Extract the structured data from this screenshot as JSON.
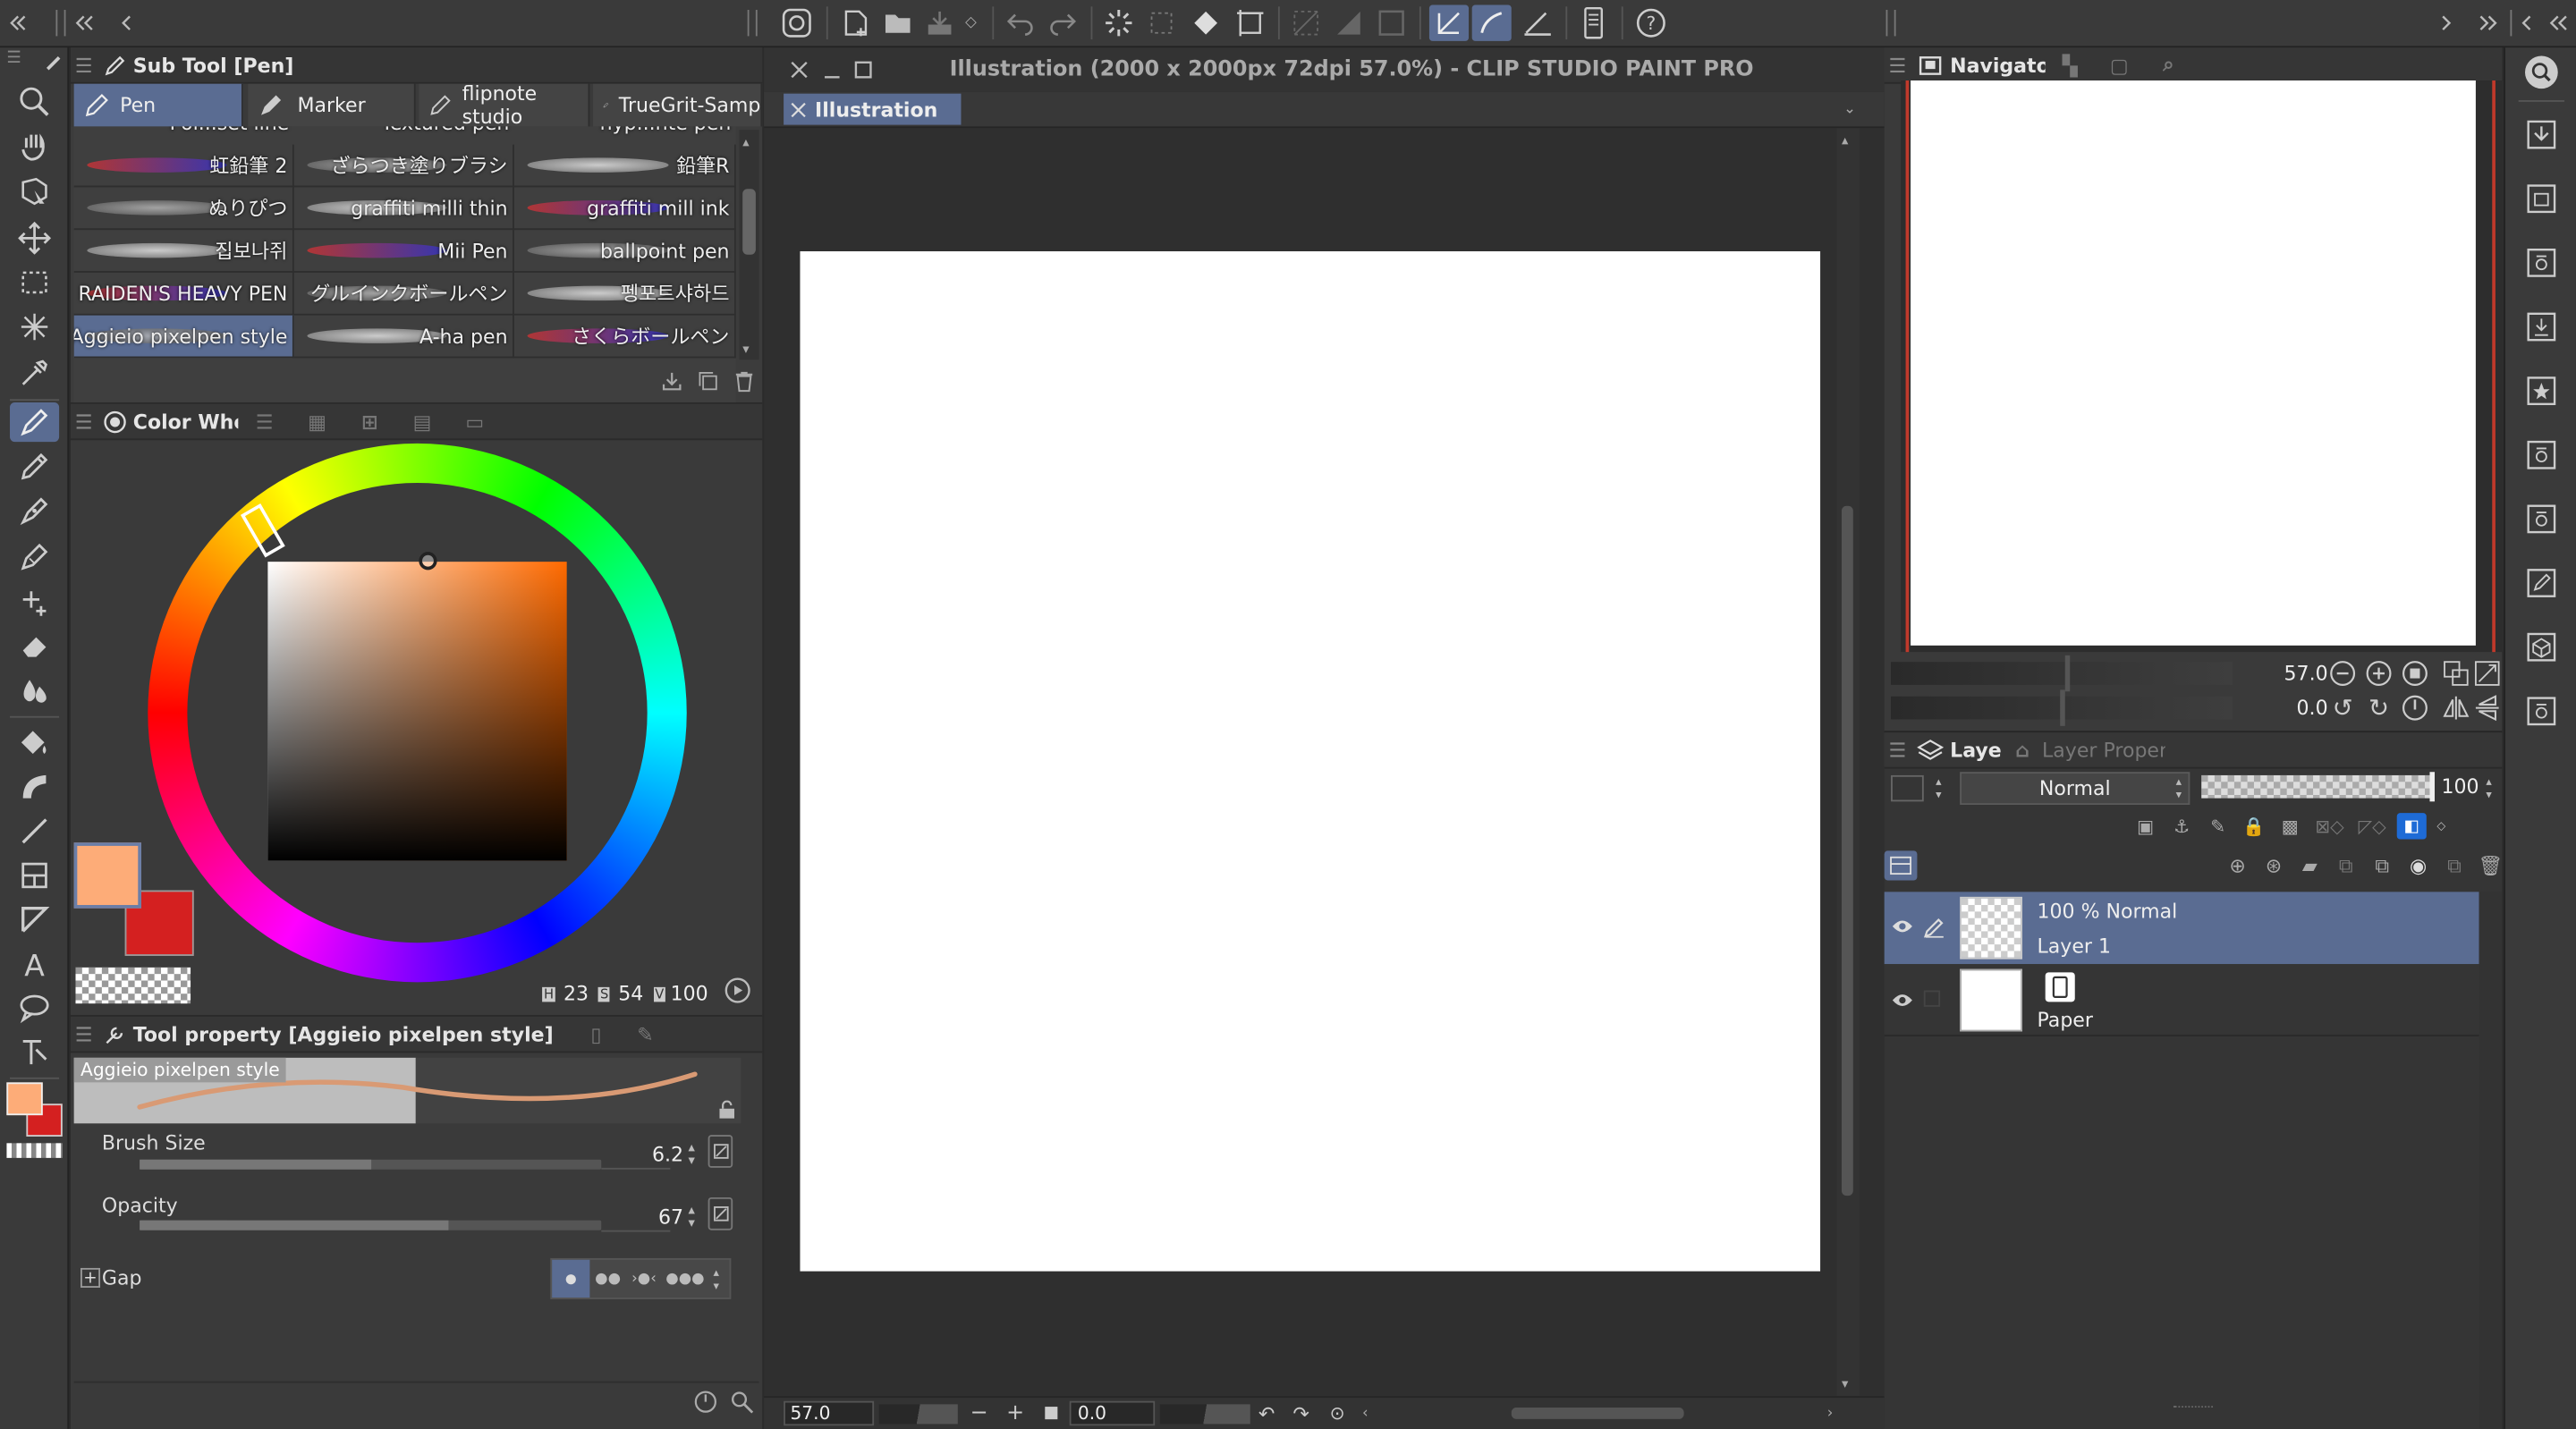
{
  "window": {
    "title": "Illustration (2000 x 2000px 72dpi 57.0%)  - CLIP STUDIO PAINT PRO",
    "tab": "Illustration"
  },
  "subtool": {
    "title": "Sub Tool [Pen]",
    "tabs": [
      "Pen",
      "Marker",
      "flipnote studio",
      "TrueGrit-Samp"
    ],
    "partial_row": [
      "Pol...set line",
      "Textured pen",
      "hyp...nte pen"
    ],
    "brushes": [
      [
        "虹鉛筆 2",
        "ざらつき塗りブラシ",
        "鉛筆R"
      ],
      [
        "ぬりぴつ",
        "graffiti milli thin",
        "graffiti mill ink"
      ],
      [
        "집보나쥐",
        "Mii Pen",
        "ballpoint pen"
      ],
      [
        "RAIDEN'S HEAVY PEN",
        "グルインクボールペン",
        "펭포트샤하드"
      ],
      [
        "Aggieio pixelpen style",
        "A-ha pen",
        "さくらボールペン"
      ]
    ]
  },
  "color": {
    "title": "Color Whee",
    "main": "#fdac78",
    "sub": "#d42020",
    "h": "23",
    "s": "54",
    "v": "100",
    "h_label": "H",
    "s_label": "S",
    "v_label": "V"
  },
  "toolprop": {
    "title": "Tool property [Aggieio pixelpen style]",
    "preview_name": "Aggieio pixelpen style",
    "brush_size_label": "Brush Size",
    "brush_size": "6.2",
    "brush_size_level": 0.5,
    "opacity_label": "Opacity",
    "opacity": "67",
    "opacity_level": 0.67,
    "gap_label": "Gap"
  },
  "canvas": {
    "zoom": "57.0",
    "angle": "0.0"
  },
  "navigator": {
    "title": "Navigator",
    "zoom": "57.0",
    "angle": "0.0"
  },
  "layers": {
    "tab_layer": "Layer",
    "tab_property": "Layer Property",
    "blend_mode": "Normal",
    "opacity": "100",
    "items": [
      {
        "label": "100 % Normal",
        "name": "Layer 1"
      },
      {
        "label": "",
        "name": "Paper"
      }
    ]
  }
}
